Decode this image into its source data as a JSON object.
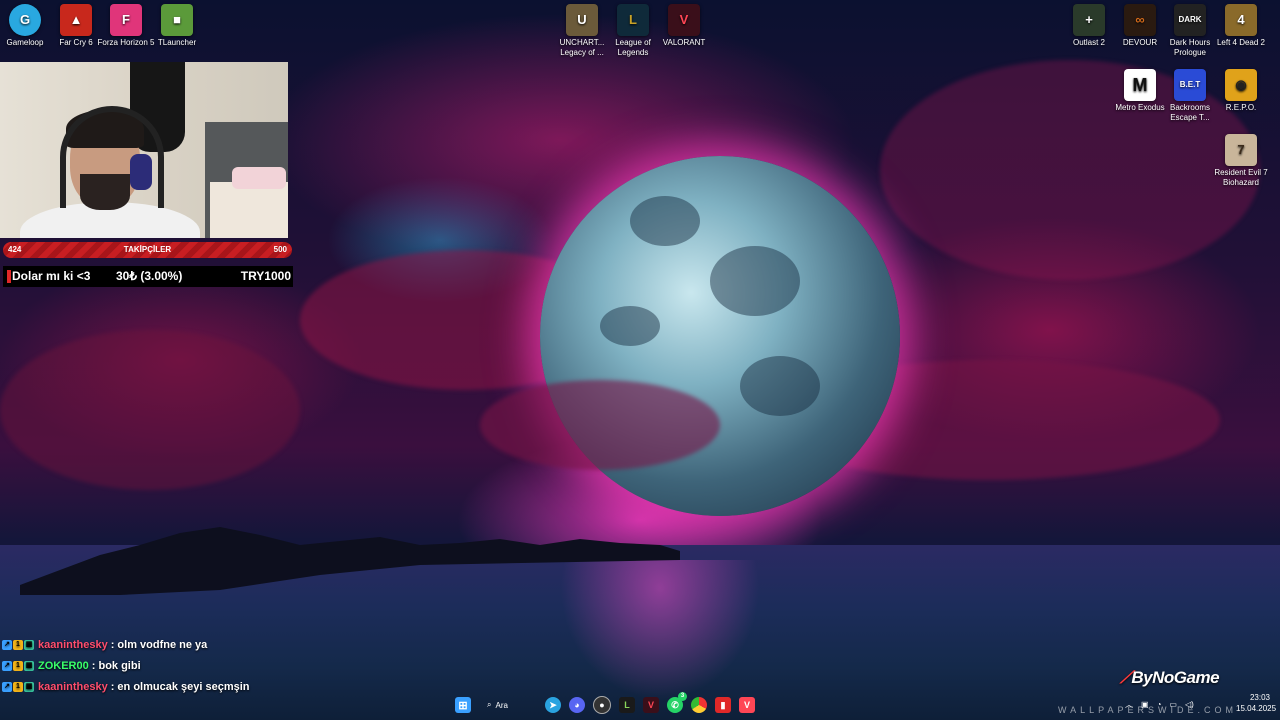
{
  "desktop_left_icons": [
    {
      "label": "Gameloop",
      "icon": "gameloop-icon",
      "color": "#29a8e0"
    },
    {
      "label": "Far Cry 6",
      "icon": "farcry6-icon",
      "color": "#c8281c"
    },
    {
      "label": "Forza Horizon 5",
      "icon": "forza-icon",
      "color": "#e0357a"
    },
    {
      "label": "TLauncher",
      "icon": "tlauncher-icon",
      "color": "#5b9a3a"
    }
  ],
  "desktop_center_icons": [
    {
      "label": "UNCHART... Legacy of ...",
      "icon": "uncharted-icon",
      "color": "#6b5a3a"
    },
    {
      "label": "League of Legends",
      "icon": "lol-icon",
      "color": "#c9a227"
    },
    {
      "label": "VALORANT",
      "icon": "valorant-icon",
      "color": "#ff4655"
    }
  ],
  "desktop_right_icons": [
    {
      "label": "Outlast 2",
      "icon": "outlast2-icon",
      "color": "#2a3a2a"
    },
    {
      "label": "DEVOUR",
      "icon": "devour-icon",
      "color": "#d46a1a"
    },
    {
      "label": "Dark Hours Prologue",
      "icon": "darkhours-icon",
      "color": "#222"
    },
    {
      "label": "Left 4 Dead 2",
      "icon": "l4d2-icon",
      "color": "#8a6a2a"
    },
    {
      "label": "Metro Exodus",
      "icon": "metro-icon",
      "color": "#111"
    },
    {
      "label": "Backrooms Escape T...",
      "icon": "backrooms-icon",
      "color": "#2a4bd6"
    },
    {
      "label": "R.E.P.O.",
      "icon": "repo-icon",
      "color": "#e0a21a"
    },
    {
      "label": "Resident Evil 7 Biohazard",
      "icon": "re7-icon",
      "color": "#c9b59a"
    }
  ],
  "follower_bar": {
    "current": "424",
    "label": "TAKİPÇİLER",
    "goal": "500"
  },
  "donation_goal": {
    "text": "Dolar mı ki <3",
    "amount": "30₺ (3.00%)",
    "target": "TRY1000"
  },
  "chat": [
    {
      "user": "kaaninthesky",
      "user_color": "#ff4d6d",
      "message": ": olm vodfne ne ya"
    },
    {
      "user": "ZOKER00",
      "user_color": "#39ff6a",
      "message": ": bok gibi"
    },
    {
      "user": "kaaninthesky",
      "user_color": "#ff4d6d",
      "message": ": en olmucak şeyi seçmşin"
    }
  ],
  "taskbar": {
    "search_label": "Ara",
    "apps": [
      {
        "icon": "windows-start-icon",
        "color": "#3aa0ff"
      },
      {
        "icon": "telegram-icon",
        "color": "#2aa3e0"
      },
      {
        "icon": "discord-icon",
        "color": "#5865f2"
      },
      {
        "icon": "obs-icon",
        "color": "#333"
      },
      {
        "icon": "gog-icon",
        "color": "#8a5ad6"
      },
      {
        "icon": "vanguard-icon",
        "color": "#c8281c"
      },
      {
        "icon": "whatsapp-icon",
        "color": "#25d366"
      },
      {
        "icon": "chrome-icon",
        "color": "#e0a21a"
      },
      {
        "icon": "app-red-icon",
        "color": "#e02828"
      },
      {
        "icon": "valorant-taskbar-icon",
        "color": "#ff4655"
      }
    ],
    "whatsapp_badge": "3"
  },
  "clock": {
    "time": "23:03",
    "date": "15.04.2025"
  },
  "brand": {
    "text": "ByNoGame"
  },
  "watermark": "WALLPAPERSWIDE.COM"
}
